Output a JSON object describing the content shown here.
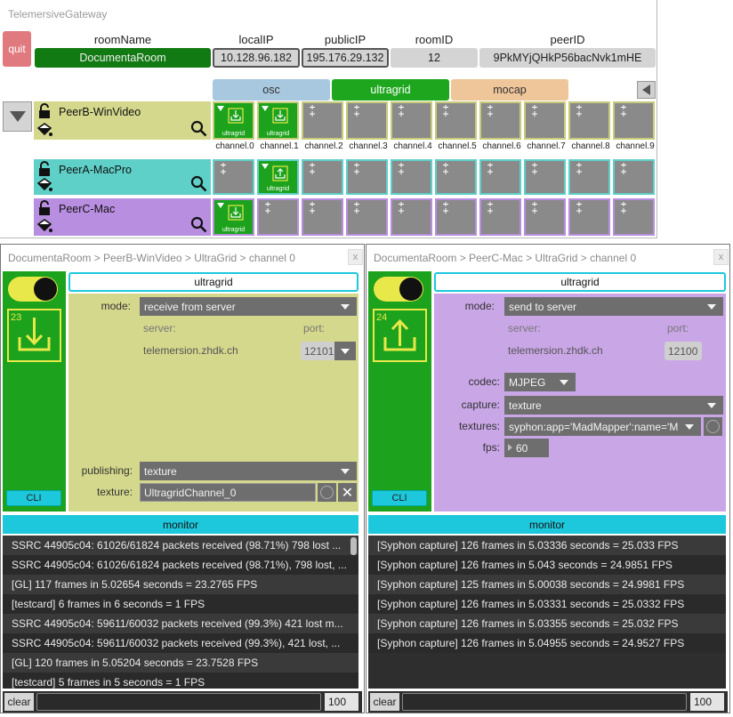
{
  "app": {
    "title": "TelemersiveGateway",
    "quit_label": "quit"
  },
  "fields": {
    "roomName": {
      "label": "roomName",
      "value": "DocumentaRoom"
    },
    "localIP": {
      "label": "localIP",
      "value": "10.128.96.182"
    },
    "publicIP": {
      "label": "publicIP",
      "value": "195.176.29.132"
    },
    "roomID": {
      "label": "roomID",
      "value": "12"
    },
    "peerID": {
      "label": "peerID",
      "value": "9PkMYjQHkP56bacNvk1mHE"
    }
  },
  "tabs": {
    "osc": "osc",
    "ultragrid": "ultragrid",
    "mocap": "mocap"
  },
  "channel_labels": [
    "channel.0",
    "channel.1",
    "channel.2",
    "channel.3",
    "channel.4",
    "channel.5",
    "channel.6",
    "channel.7",
    "channel.8",
    "channel.9"
  ],
  "cell_label": "ultragrid",
  "peers": [
    {
      "name": "PeerB-WinVideo",
      "color": "#d4d88c",
      "border": "#c8cc7a"
    },
    {
      "name": "PeerA-MacPro",
      "color": "#5ed0c8",
      "border": "#5ed0c8"
    },
    {
      "name": "PeerC-Mac",
      "color": "#b88ee0",
      "border": "#b88ee0"
    }
  ],
  "window_left": {
    "breadcrumb": "DocumentaRoom > PeerB-WinVideo > UltraGrid > channel 0",
    "close_label": "x",
    "type": "ultragrid",
    "channel_number": "23",
    "cli_label": "CLI",
    "mode_label": "mode:",
    "mode_value": "receive from server",
    "server_label": "server:",
    "server_value": "telemersion.zhdk.ch",
    "port_label": "port:",
    "port_value": "12101",
    "publishing_label": "publishing:",
    "publishing_value": "texture",
    "texture_label": "texture:",
    "texture_value": "UltragridChannel_0",
    "panel_color": "#d4d88c",
    "monitor_label": "monitor",
    "monitor_lines": [
      "SSRC 44905c04: 61026/61824 packets received (98.71%) 798 lost ...",
      "SSRC 44905c04: 61026/61824 packets received (98.71%), 798 lost, ...",
      "[GL] 117 frames in 5.02654 seconds = 23.2765 FPS",
      "[testcard] 6 frames in 6 seconds = 1 FPS",
      "SSRC 44905c04: 59611/60032 packets received (99.3%) 421 lost m...",
      "SSRC 44905c04: 59611/60032 packets received (99.3%), 421 lost, ...",
      "[GL] 120 frames in 5.05204 seconds = 23.7528 FPS",
      "[testcard] 5 frames in 5 seconds = 1 FPS"
    ],
    "clear_label": "clear",
    "count_value": "100"
  },
  "window_right": {
    "breadcrumb": "DocumentaRoom > PeerC-Mac > UltraGrid > channel 0",
    "close_label": "x",
    "type": "ultragrid",
    "channel_number": "24",
    "cli_label": "CLI",
    "mode_label": "mode:",
    "mode_value": "send to server",
    "server_label": "server:",
    "server_value": "telemersion.zhdk.ch",
    "port_label": "port:",
    "port_value": "12100",
    "codec_label": "codec:",
    "codec_value": "MJPEG",
    "capture_label": "capture:",
    "capture_value": "texture",
    "textures_label": "textures:",
    "textures_value": "syphon:app='MadMapper':name='M",
    "fps_label": "fps:",
    "fps_value": "60",
    "panel_color": "#c9a6e6",
    "monitor_label": "monitor",
    "monitor_lines": [
      "[Syphon capture] 126 frames in 5.03336 seconds = 25.033 FPS",
      "[Syphon capture] 126 frames in 5.043 seconds = 24.9851 FPS",
      "[Syphon capture] 125 frames in 5.00038 seconds = 24.9981 FPS",
      "[Syphon capture] 126 frames in 5.03331 seconds = 25.0332 FPS",
      "[Syphon capture] 126 frames in 5.03355 seconds = 25.032 FPS",
      "[Syphon capture] 126 frames in 5.04955 seconds = 24.9527 FPS"
    ],
    "clear_label": "clear",
    "count_value": "100"
  }
}
